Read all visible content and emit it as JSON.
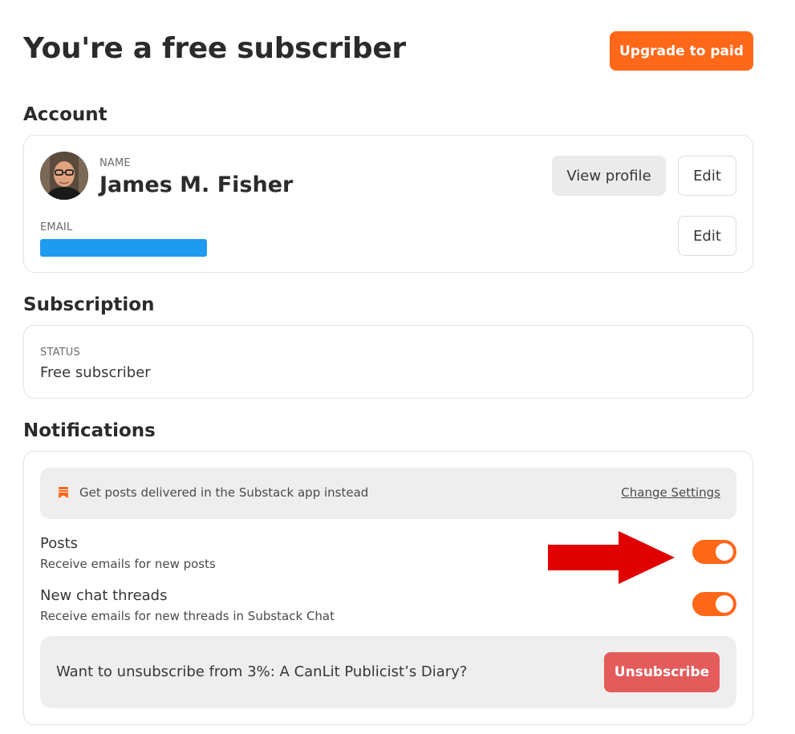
{
  "header": {
    "title": "You're a free subscriber",
    "upgrade_label": "Upgrade to paid"
  },
  "account": {
    "section_title": "Account",
    "name_label": "NAME",
    "name_value": "James M. Fisher",
    "view_profile_label": "View profile",
    "edit_name_label": "Edit",
    "email_label": "EMAIL",
    "email_value_redacted": true,
    "edit_email_label": "Edit"
  },
  "subscription": {
    "section_title": "Subscription",
    "status_label": "STATUS",
    "status_value": "Free subscriber"
  },
  "notifications": {
    "section_title": "Notifications",
    "banner_text": "Get posts delivered in the Substack app instead",
    "banner_link": "Change Settings",
    "rows": [
      {
        "title": "Posts",
        "subtitle": "Receive emails for new posts",
        "enabled": true
      },
      {
        "title": "New chat threads",
        "subtitle": "Receive emails for new threads in Substack Chat",
        "enabled": true
      }
    ],
    "unsubscribe_prompt": "Want to unsubscribe from 3%: A CanLit Publicist’s Diary?",
    "unsubscribe_label": "Unsubscribe"
  },
  "colors": {
    "accent": "#ff6719",
    "danger": "#e45b5b",
    "annotation_arrow": "#e00000",
    "email_redaction": "#1d9bf0"
  },
  "icons": {
    "banner": "bookmark-icon",
    "annotation": "red-arrow-annotation"
  }
}
